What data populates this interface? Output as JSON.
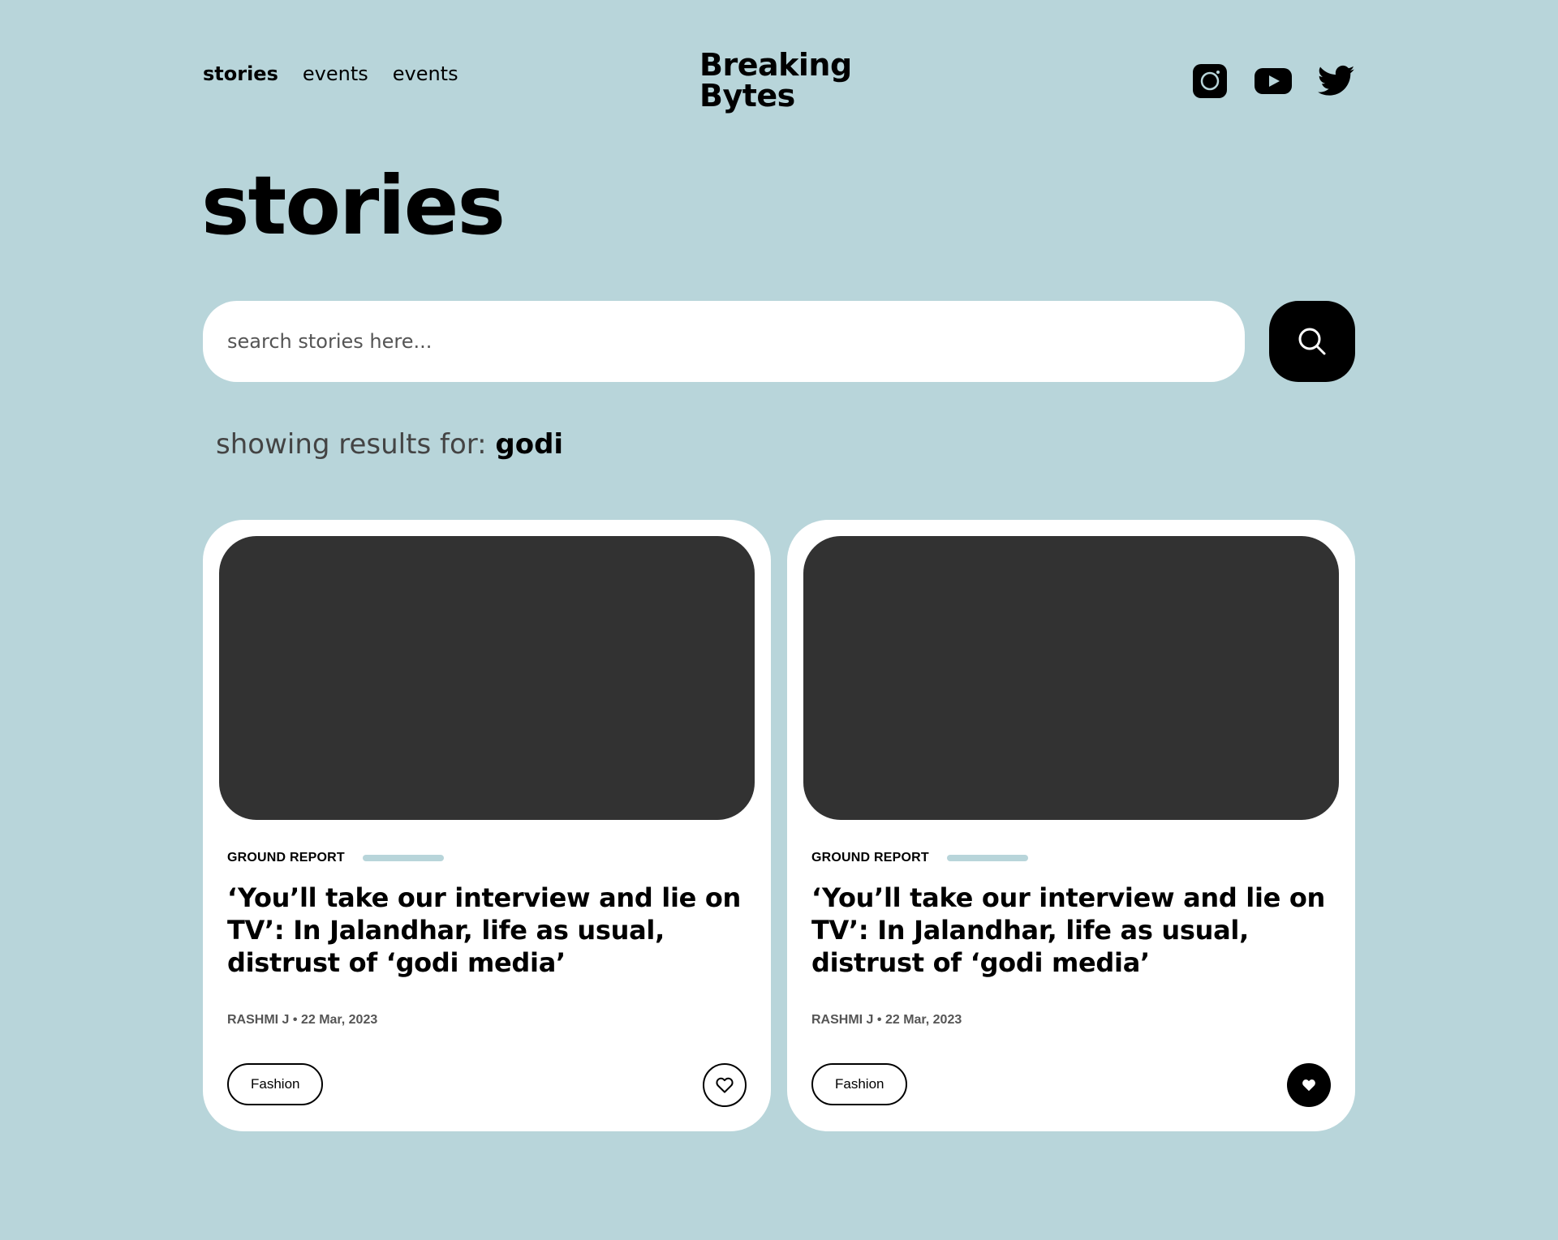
{
  "nav": {
    "items": [
      {
        "label": "stories",
        "active": true
      },
      {
        "label": "events",
        "active": false
      },
      {
        "label": "events",
        "active": false
      }
    ]
  },
  "logo": {
    "line1": "Breaking",
    "line2": "Bytes"
  },
  "socials": [
    "instagram-icon",
    "youtube-icon",
    "twitter-icon"
  ],
  "page": {
    "title": "stories"
  },
  "search": {
    "placeholder": "search stories here...",
    "value": "",
    "icon": "search-icon"
  },
  "results": {
    "prefix": "showing results for: ",
    "term": "godi"
  },
  "colors": {
    "background": "#b8d5da",
    "card": "#ffffff",
    "thumbnail": "#323232",
    "accent": "#000000"
  },
  "cards": [
    {
      "category": "GROUND REPORT",
      "headline": "‘You’ll take our interview and lie on TV’: In Jalandhar, life as usual, distrust of ‘godi media’",
      "meta": "RASHMI J • 22 Mar, 2023",
      "tag": "Fashion",
      "liked": false
    },
    {
      "category": "GROUND REPORT",
      "headline": "‘You’ll take our interview and lie on TV’: In Jalandhar, life as usual, distrust of ‘godi media’",
      "meta": "RASHMI J • 22 Mar, 2023",
      "tag": "Fashion",
      "liked": true
    }
  ]
}
